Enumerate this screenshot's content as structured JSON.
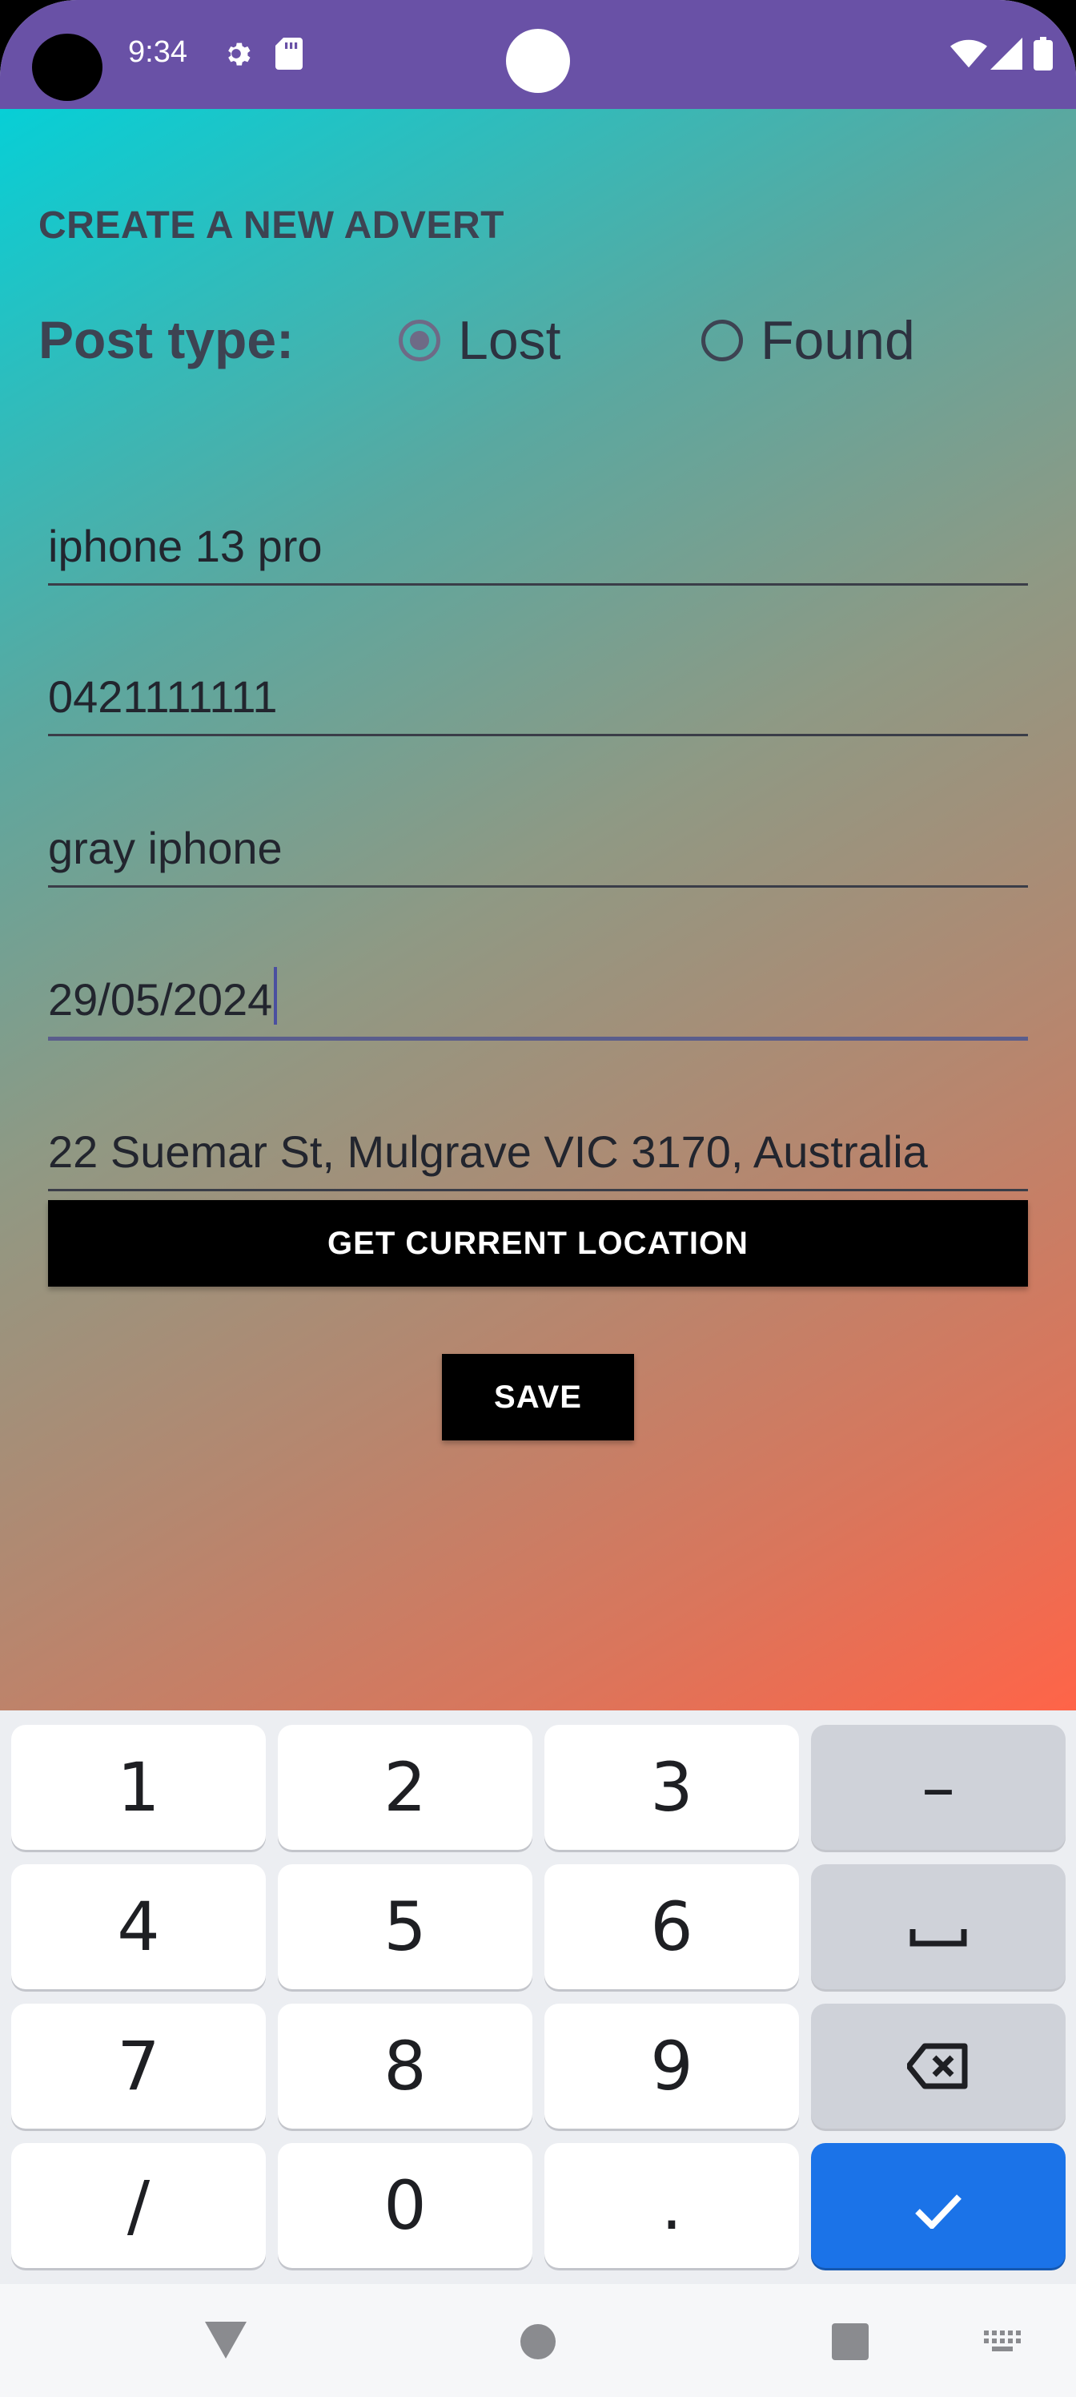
{
  "status_bar": {
    "time": "9:34",
    "icons": [
      "gear-icon",
      "sd-card-icon",
      "wifi-icon",
      "signal-icon",
      "battery-icon"
    ]
  },
  "page": {
    "title": "CREATE A NEW ADVERT",
    "post_type_label": "Post type:",
    "post_type_options": [
      {
        "label": "Lost",
        "selected": true
      },
      {
        "label": "Found",
        "selected": false
      }
    ]
  },
  "fields": {
    "name": "iphone 13 pro",
    "phone": "0421111111",
    "description": "gray iphone",
    "date": "29/05/2024",
    "location": "22 Suemar St, Mulgrave VIC 3170, Australia"
  },
  "buttons": {
    "get_location": "GET CURRENT LOCATION",
    "save": "SAVE"
  },
  "keyboard": {
    "keys": [
      "1",
      "2",
      "3",
      "–",
      "4",
      "5",
      "6",
      "␣",
      "7",
      "8",
      "9",
      "⌫",
      "/",
      "0",
      ".",
      "✓"
    ],
    "icons": [
      "space-icon",
      "backspace-icon",
      "check-icon"
    ],
    "enter_color": "#1b73e8"
  },
  "nav_bar": {
    "icons": [
      "back-icon",
      "home-icon",
      "recents-icon",
      "keyboard-switch-icon"
    ]
  },
  "colors": {
    "status_bar": "#6951a6",
    "gradient_start": "#07cfd6",
    "gradient_end": "#ff6448",
    "button": "#000000"
  }
}
